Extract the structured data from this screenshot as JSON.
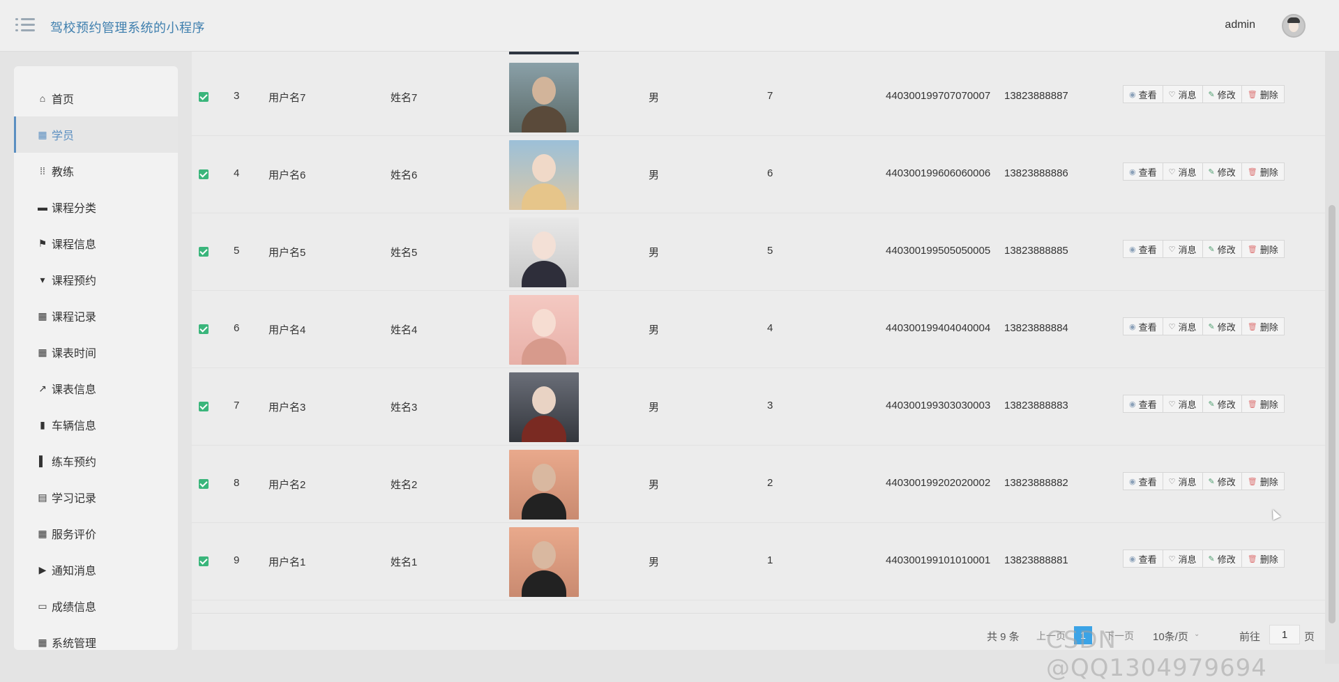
{
  "app": {
    "title": "驾校预约管理系统的小程序",
    "user": "admin"
  },
  "sidebar": {
    "items": [
      {
        "label": "首页",
        "icon": "home-icon"
      },
      {
        "label": "学员",
        "icon": "grid-icon"
      },
      {
        "label": "教练",
        "icon": "apps-icon"
      },
      {
        "label": "课程分类",
        "icon": "briefcase-icon"
      },
      {
        "label": "课程信息",
        "icon": "flag-icon"
      },
      {
        "label": "课程预约",
        "icon": "brush-icon"
      },
      {
        "label": "课程记录",
        "icon": "grid-icon"
      },
      {
        "label": "课表时间",
        "icon": "grid-icon"
      },
      {
        "label": "课表信息",
        "icon": "trend-icon"
      },
      {
        "label": "车辆信息",
        "icon": "bars-icon"
      },
      {
        "label": "练车预约",
        "icon": "chart-icon"
      },
      {
        "label": "学习记录",
        "icon": "clipboard-icon"
      },
      {
        "label": "服务评价",
        "icon": "grid-icon"
      },
      {
        "label": "通知消息",
        "icon": "video-icon"
      },
      {
        "label": "成绩信息",
        "icon": "inbox-icon"
      },
      {
        "label": "系统管理",
        "icon": "grid-icon"
      }
    ]
  },
  "table": {
    "rows": [
      {
        "idx": "3",
        "username": "用户名7",
        "name": "姓名7",
        "gender": "男",
        "age": "7",
        "idcard": "440300199707070007",
        "phone": "13823888887"
      },
      {
        "idx": "4",
        "username": "用户名6",
        "name": "姓名6",
        "gender": "男",
        "age": "6",
        "idcard": "440300199606060006",
        "phone": "13823888886"
      },
      {
        "idx": "5",
        "username": "用户名5",
        "name": "姓名5",
        "gender": "男",
        "age": "5",
        "idcard": "440300199505050005",
        "phone": "13823888885"
      },
      {
        "idx": "6",
        "username": "用户名4",
        "name": "姓名4",
        "gender": "男",
        "age": "4",
        "idcard": "440300199404040004",
        "phone": "13823888884"
      },
      {
        "idx": "7",
        "username": "用户名3",
        "name": "姓名3",
        "gender": "男",
        "age": "3",
        "idcard": "440300199303030003",
        "phone": "13823888883"
      },
      {
        "idx": "8",
        "username": "用户名2",
        "name": "姓名2",
        "gender": "男",
        "age": "2",
        "idcard": "440300199202020002",
        "phone": "13823888882"
      },
      {
        "idx": "9",
        "username": "用户名1",
        "name": "姓名1",
        "gender": "男",
        "age": "1",
        "idcard": "440300199101010001",
        "phone": "13823888881"
      }
    ],
    "actions": {
      "view": "查看",
      "message": "消息",
      "edit": "修改",
      "delete": "删除"
    }
  },
  "pagination": {
    "total": "共 9 条",
    "prev": "上一页",
    "current": "1",
    "next": "下一页",
    "page_size": "10条/页",
    "goto_prefix": "前往",
    "goto_value": "1",
    "goto_suffix": "页"
  },
  "watermark": "CSDN @QQ1304979694"
}
